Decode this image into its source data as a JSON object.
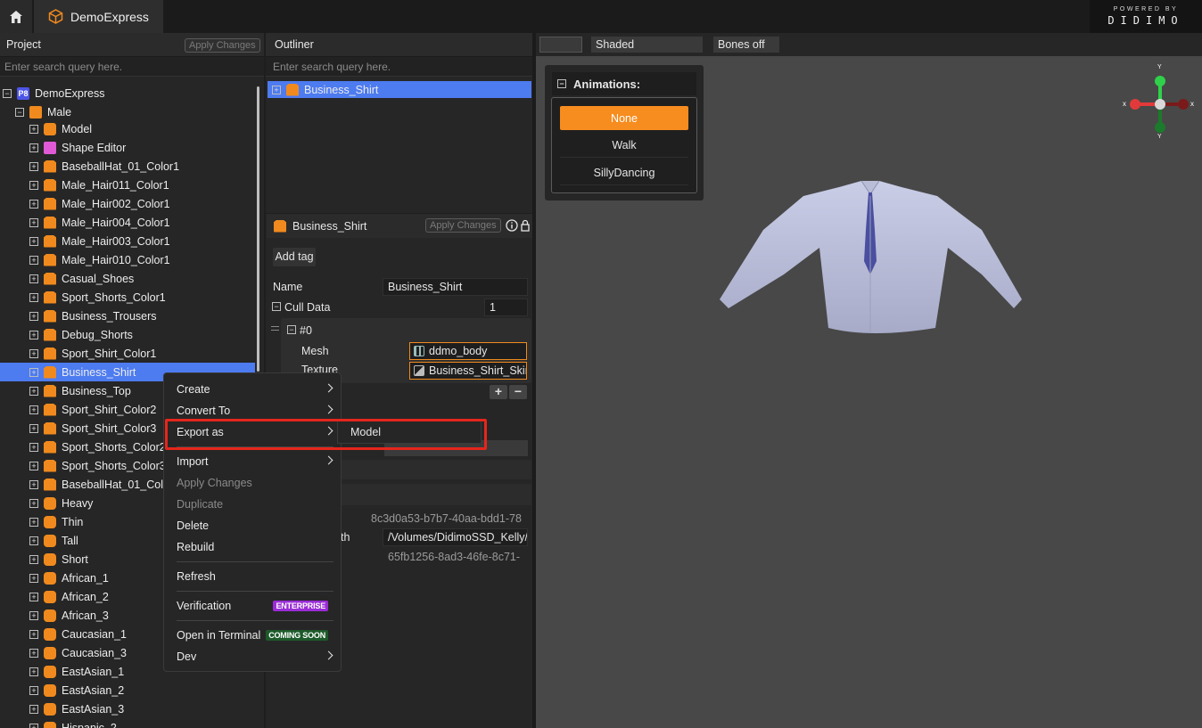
{
  "app": {
    "tab_title": "DemoExpress"
  },
  "brand": {
    "small": "POWERED BY",
    "big": "DIDIMO"
  },
  "project": {
    "title": "Project",
    "apply_label": "Apply Changes",
    "search_placeholder": "Enter search query here.",
    "root": "DemoExpress",
    "group": "Male",
    "items": [
      {
        "label": "Model",
        "icon": "model-icon"
      },
      {
        "label": "Shape Editor",
        "icon": "shape-editor-icon"
      },
      {
        "label": "BaseballHat_01_Color1",
        "icon": "garment-icon"
      },
      {
        "label": "Male_Hair011_Color1",
        "icon": "garment-icon"
      },
      {
        "label": "Male_Hair002_Color1",
        "icon": "garment-icon"
      },
      {
        "label": "Male_Hair004_Color1",
        "icon": "garment-icon"
      },
      {
        "label": "Male_Hair003_Color1",
        "icon": "garment-icon"
      },
      {
        "label": "Male_Hair010_Color1",
        "icon": "garment-icon"
      },
      {
        "label": "Casual_Shoes",
        "icon": "garment-icon"
      },
      {
        "label": "Sport_Shorts_Color1",
        "icon": "garment-icon"
      },
      {
        "label": "Business_Trousers",
        "icon": "garment-icon"
      },
      {
        "label": "Debug_Shorts",
        "icon": "garment-icon"
      },
      {
        "label": "Sport_Shirt_Color1",
        "icon": "garment-icon"
      },
      {
        "label": "Business_Shirt",
        "icon": "garment-icon",
        "selected": true
      },
      {
        "label": "Business_Top",
        "icon": "garment-icon"
      },
      {
        "label": "Sport_Shirt_Color2",
        "icon": "garment-icon"
      },
      {
        "label": "Sport_Shirt_Color3",
        "icon": "garment-icon"
      },
      {
        "label": "Sport_Shorts_Color2",
        "icon": "garment-icon"
      },
      {
        "label": "Sport_Shorts_Color3",
        "icon": "garment-icon"
      },
      {
        "label": "BaseballHat_01_Colo",
        "icon": "garment-icon"
      },
      {
        "label": "Heavy",
        "icon": "morph-icon"
      },
      {
        "label": "Thin",
        "icon": "morph-icon"
      },
      {
        "label": "Tall",
        "icon": "morph-icon"
      },
      {
        "label": "Short",
        "icon": "morph-icon"
      },
      {
        "label": "African_1",
        "icon": "morph-icon"
      },
      {
        "label": "African_2",
        "icon": "morph-icon"
      },
      {
        "label": "African_3",
        "icon": "morph-icon"
      },
      {
        "label": "Caucasian_1",
        "icon": "morph-icon"
      },
      {
        "label": "Caucasian_3",
        "icon": "morph-icon"
      },
      {
        "label": "EastAsian_1",
        "icon": "morph-icon"
      },
      {
        "label": "EastAsian_2",
        "icon": "morph-icon"
      },
      {
        "label": "EastAsian_3",
        "icon": "morph-icon"
      },
      {
        "label": "Hispanic_2",
        "icon": "morph-icon"
      }
    ]
  },
  "outliner": {
    "title": "Outliner",
    "search_placeholder": "Enter search query here.",
    "selected": "Business_Shirt"
  },
  "inspector": {
    "title": "Business_Shirt",
    "apply_label": "Apply Changes",
    "add_tag": "Add tag",
    "name_label": "Name",
    "name_value": "Business_Shirt",
    "cull_label": "Cull Data",
    "cull_value": "1",
    "entry_label": "#0",
    "mesh_label": "Mesh",
    "mesh_value": "ddmo_body",
    "texture_label": "Texture",
    "texture_value": "Business_Shirt_Skin",
    "id_value": "8c3d0a53-b7b7-40aa-bdd1-78",
    "path_label_fragment": "th",
    "path_value": "/Volumes/DidimoSSD_Kelly/",
    "guid_value": "65fb1256-8ad3-46fe-8c71-"
  },
  "viewport": {
    "shading": "Shaded",
    "bones": "Bones off",
    "animations_title": "Animations:",
    "animations": [
      "None",
      "Walk",
      "SillyDancing"
    ],
    "active_animation": "None",
    "gizmo_axis_x": "x",
    "gizmo_axis_y": "Y"
  },
  "context_menu": {
    "items": {
      "create": "Create",
      "convert_to": "Convert To",
      "export_as": "Export as",
      "import": "Import",
      "apply_changes": "Apply Changes",
      "duplicate": "Duplicate",
      "delete": "Delete",
      "rebuild": "Rebuild",
      "refresh": "Refresh",
      "verification": "Verification",
      "open_terminal": "Open in Terminal",
      "dev": "Dev"
    },
    "badge_enterprise": "ENTERPRISE",
    "badge_soon": "COMING SOON",
    "submenu_model": "Model"
  },
  "colors": {
    "accent": "#f78c1f",
    "selection": "#4d7bf0",
    "highlight": "#e5261c"
  }
}
